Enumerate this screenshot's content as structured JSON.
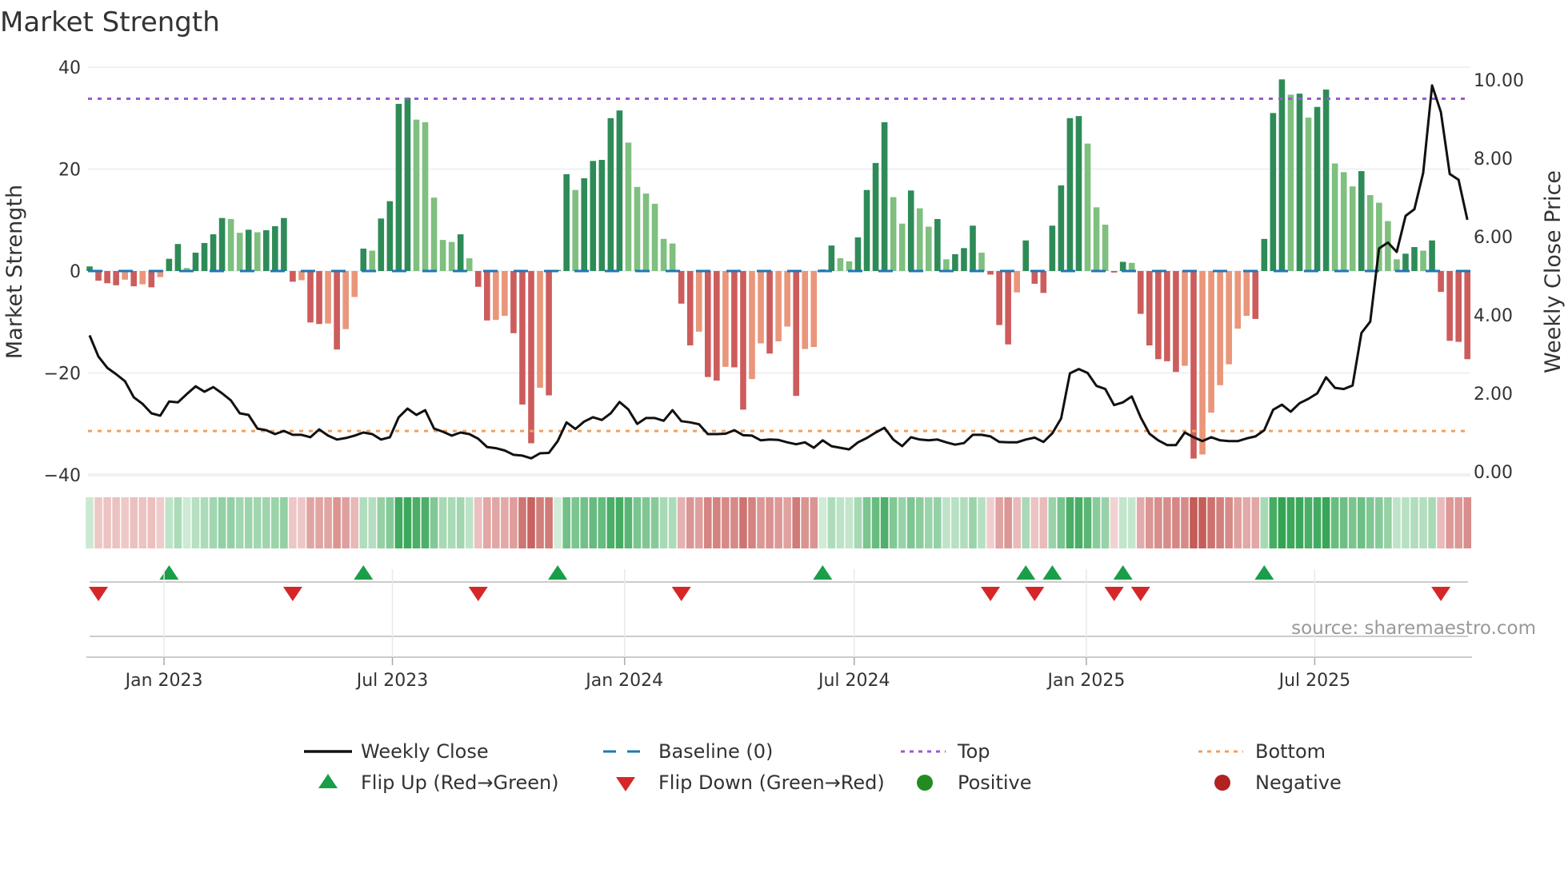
{
  "chart_data": {
    "type": "bar",
    "title": "Market Strength",
    "ylabel": "Market Strength",
    "y2label": "Weekly Close Price",
    "ylim": [
      -40,
      40
    ],
    "y2lim": [
      0,
      10
    ],
    "yticks": [
      "40",
      "20",
      "0",
      "−20",
      "−40"
    ],
    "ytick_values": [
      40,
      20,
      0,
      -20,
      -40
    ],
    "y2ticks": [
      "10.00",
      "8.00",
      "6.00",
      "4.00",
      "2.00",
      "0.00"
    ],
    "y2tick_values": [
      10,
      8,
      6,
      4,
      2,
      0
    ],
    "first_week": "2022-11-03",
    "frequency": "weekly",
    "xticks": [
      {
        "label": "Jan 2023",
        "date": "2023-01-01"
      },
      {
        "label": "Jul 2023",
        "date": "2023-07-01"
      },
      {
        "label": "Jan 2024",
        "date": "2024-01-01"
      },
      {
        "label": "Jul 2024",
        "date": "2024-07-01"
      },
      {
        "label": "Jan 2025",
        "date": "2025-01-01"
      },
      {
        "label": "Jul 2025",
        "date": "2025-07-01"
      }
    ],
    "top_level": 33.8,
    "bottom_level": -31.4,
    "baseline": 0,
    "strength": [
      0.9,
      -1.9,
      -2.4,
      -2.8,
      -1.7,
      -3.0,
      -2.6,
      -3.2,
      -1.2,
      2.4,
      5.3,
      0.6,
      3.6,
      5.5,
      7.2,
      10.4,
      10.2,
      7.5,
      8.1,
      7.6,
      8.0,
      8.8,
      10.4,
      -2.1,
      -1.8,
      -10.1,
      -10.4,
      -10.3,
      -15.4,
      -11.4,
      -5.1,
      4.4,
      4.0,
      10.3,
      13.7,
      32.8,
      34.0,
      29.7,
      29.2,
      14.4,
      6.1,
      5.7,
      7.2,
      2.5,
      -3.1,
      -9.7,
      -9.6,
      -8.8,
      -12.2,
      -26.2,
      -33.8,
      -22.9,
      -24.4,
      0.2,
      19.0,
      15.9,
      18.2,
      21.6,
      21.8,
      30.0,
      31.5,
      25.2,
      16.5,
      15.2,
      13.2,
      6.3,
      5.4,
      -6.4,
      -14.6,
      -11.9,
      -20.8,
      -21.5,
      -18.8,
      -18.9,
      -27.2,
      -21.2,
      -14.2,
      -16.2,
      -13.8,
      -10.9,
      -24.5,
      -15.3,
      -14.9,
      0.3,
      5.0,
      2.5,
      1.9,
      6.6,
      15.9,
      21.2,
      29.2,
      14.5,
      9.3,
      15.8,
      12.3,
      8.7,
      10.2,
      2.3,
      3.3,
      4.5,
      8.9,
      3.6,
      -0.7,
      -10.6,
      -14.4,
      -4.2,
      6.0,
      -2.5,
      -4.3,
      8.9,
      16.8,
      30.0,
      30.4,
      25.0,
      12.5,
      9.1,
      -0.3,
      1.8,
      1.6,
      -8.4,
      -14.6,
      -17.3,
      -17.7,
      -19.8,
      -18.6,
      -36.8,
      -36.0,
      -27.8,
      -22.4,
      -18.3,
      -11.3,
      -8.8,
      -9.4,
      6.3,
      31.0,
      37.6,
      34.6,
      34.8,
      30.1,
      32.2,
      35.6,
      21.1,
      19.4,
      16.6,
      19.6,
      14.9,
      13.4,
      9.8,
      2.3,
      3.4,
      4.7,
      4.0,
      6.0,
      -4.1,
      -13.7,
      -13.9,
      -17.3
    ],
    "weekly_close": [
      3.48,
      2.94,
      2.65,
      2.49,
      2.31,
      1.9,
      1.73,
      1.49,
      1.43,
      1.79,
      1.77,
      1.98,
      2.18,
      2.04,
      2.16,
      2.0,
      1.82,
      1.49,
      1.45,
      1.1,
      1.06,
      0.96,
      1.04,
      0.94,
      0.94,
      0.88,
      1.08,
      0.92,
      0.82,
      0.86,
      0.92,
      1.0,
      0.96,
      0.82,
      0.88,
      1.39,
      1.61,
      1.45,
      1.57,
      1.1,
      1.02,
      0.92,
      1.0,
      0.96,
      0.84,
      0.63,
      0.6,
      0.54,
      0.43,
      0.41,
      0.34,
      0.47,
      0.48,
      0.78,
      1.26,
      1.09,
      1.28,
      1.39,
      1.32,
      1.49,
      1.78,
      1.59,
      1.22,
      1.37,
      1.37,
      1.3,
      1.57,
      1.29,
      1.26,
      1.21,
      0.96,
      0.96,
      0.97,
      1.06,
      0.93,
      0.92,
      0.8,
      0.82,
      0.81,
      0.75,
      0.7,
      0.75,
      0.61,
      0.8,
      0.65,
      0.61,
      0.57,
      0.75,
      0.86,
      1.0,
      1.12,
      0.82,
      0.65,
      0.88,
      0.82,
      0.8,
      0.82,
      0.75,
      0.69,
      0.73,
      0.94,
      0.94,
      0.9,
      0.76,
      0.75,
      0.75,
      0.82,
      0.87,
      0.76,
      0.98,
      1.36,
      2.51,
      2.62,
      2.52,
      2.19,
      2.11,
      1.7,
      1.77,
      1.92,
      1.39,
      0.97,
      0.8,
      0.68,
      0.68,
      1.0,
      0.88,
      0.78,
      0.88,
      0.8,
      0.78,
      0.78,
      0.85,
      0.9,
      1.06,
      1.58,
      1.71,
      1.53,
      1.75,
      1.86,
      2.0,
      2.41,
      2.14,
      2.11,
      2.2,
      3.54,
      3.83,
      5.7,
      5.85,
      5.61,
      6.53,
      6.7,
      7.63,
      9.86,
      9.18,
      7.6,
      7.45,
      6.43
    ],
    "legend": {
      "placement": "bottom",
      "items": [
        {
          "key": "close",
          "label": "Weekly Close"
        },
        {
          "key": "baseline",
          "label": "Baseline (0)"
        },
        {
          "key": "top",
          "label": "Top"
        },
        {
          "key": "bottom",
          "label": "Bottom"
        },
        {
          "key": "flip_up",
          "label": "Flip Up (Red→Green)"
        },
        {
          "key": "flip_down",
          "label": "Flip Down (Green→Red)"
        },
        {
          "key": "positive",
          "label": "Positive"
        },
        {
          "key": "negative",
          "label": "Negative"
        }
      ]
    },
    "source": "source: sharemaestro.com",
    "grid": true
  },
  "colors": {
    "rising_green": "#2e8b57",
    "falling_green": "#7fbf7f",
    "falling_red": "#cd5c5c",
    "rising_red": "#e9967a",
    "close": "#111111",
    "baseline": "#1f77b4",
    "top": "#9b59d0",
    "bottom": "#f0a060",
    "flip_up": "#1a9e4a",
    "flip_down": "#d62728",
    "positive": "#228b22",
    "negative": "#b22222",
    "grid": "#eef1f5"
  }
}
